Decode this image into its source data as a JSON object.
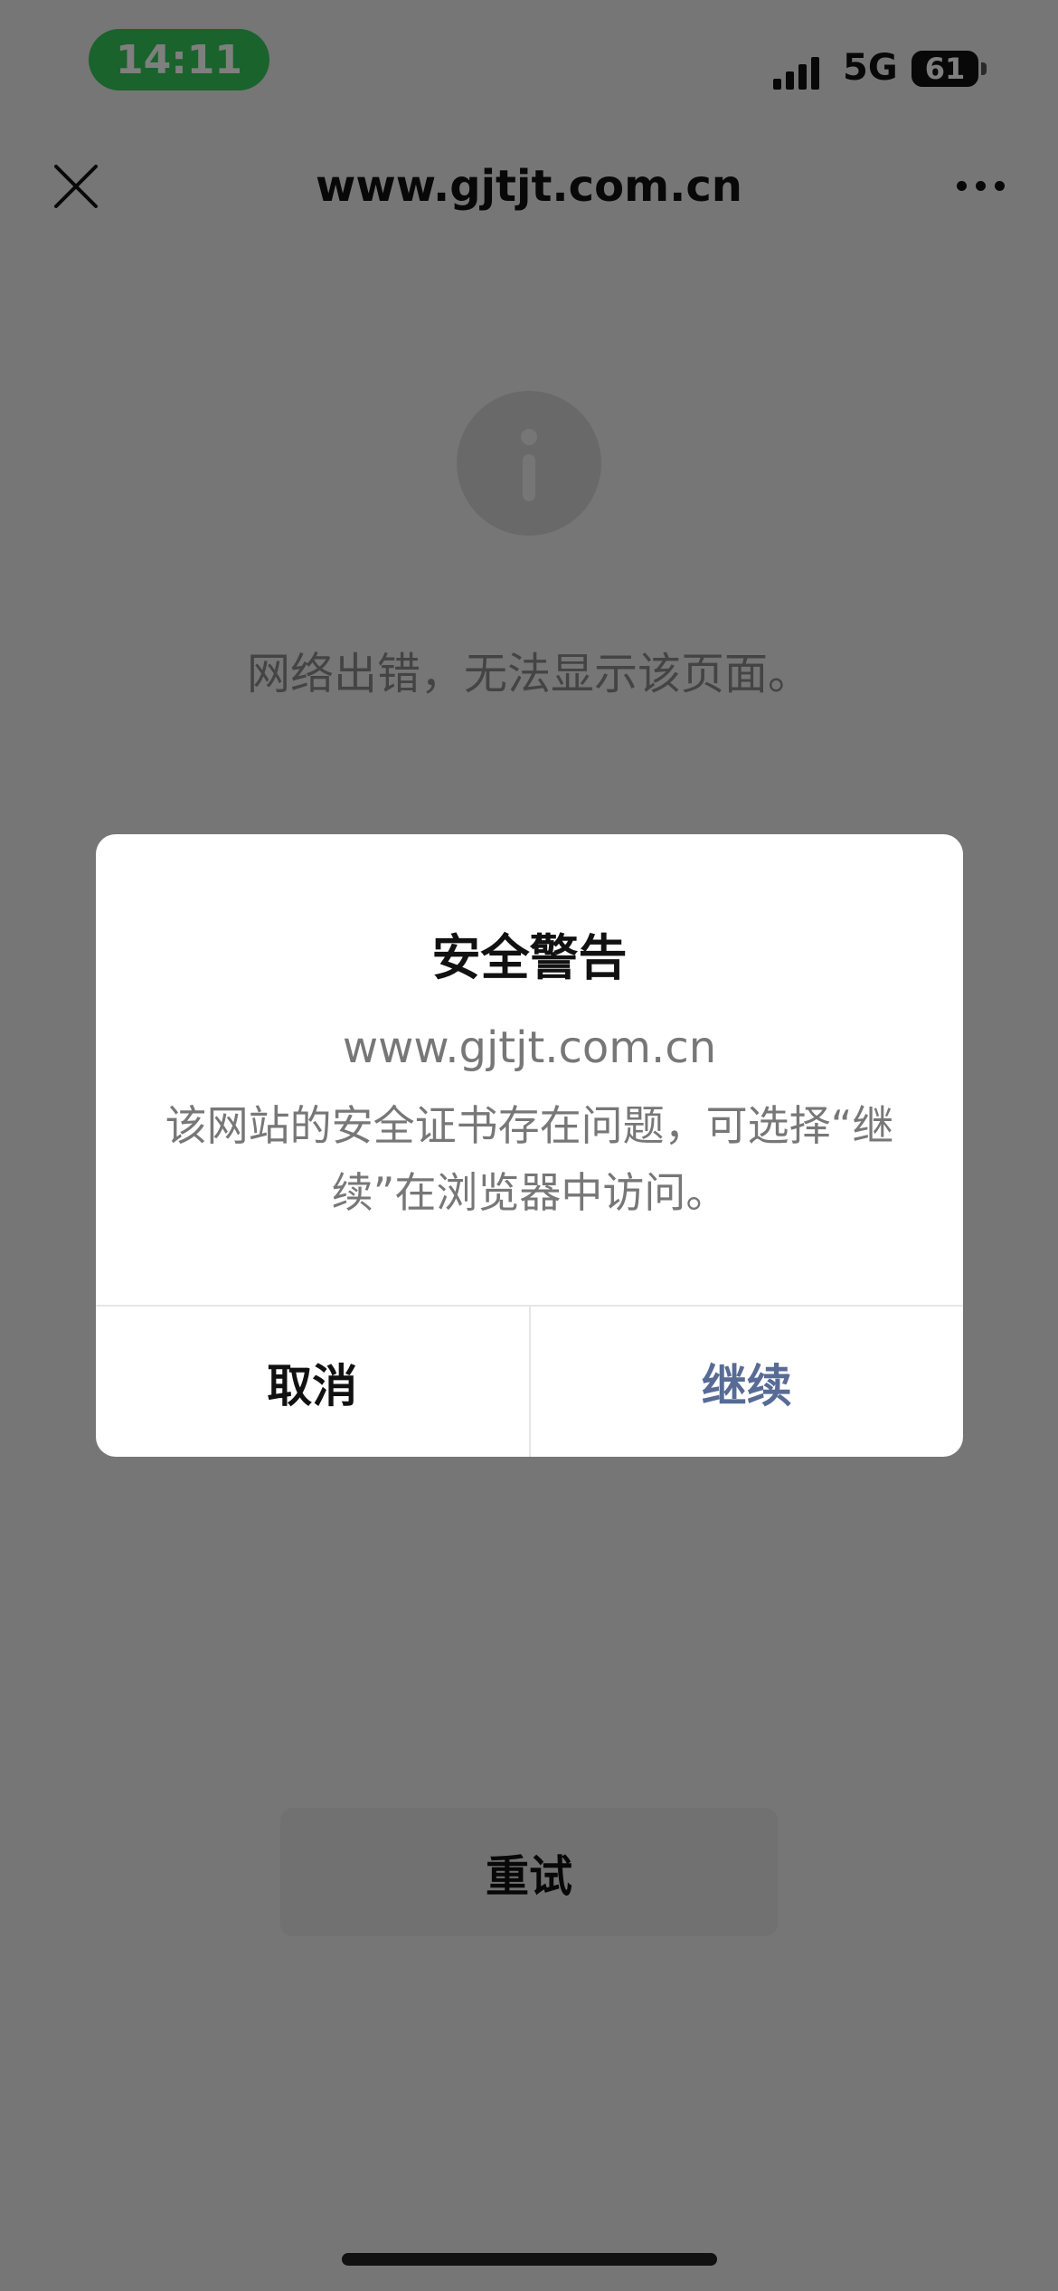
{
  "status_bar": {
    "time": "14:11",
    "network": "5G",
    "battery": "61"
  },
  "nav": {
    "url": "www.gjtjt.com.cn"
  },
  "error_page": {
    "message": "网络出错，无法显示该页面。",
    "retry_label": "重试"
  },
  "dialog": {
    "title": "安全警告",
    "url": "www.gjtjt.com.cn",
    "message": "该网站的安全证书存在问题，可选择“继续”在浏览器中访问。",
    "cancel_label": "取消",
    "continue_label": "继续"
  },
  "icons": {
    "close": "close-icon",
    "more": "more-icon",
    "info": "info-icon",
    "signal": "signal-icon",
    "battery": "battery-icon"
  }
}
